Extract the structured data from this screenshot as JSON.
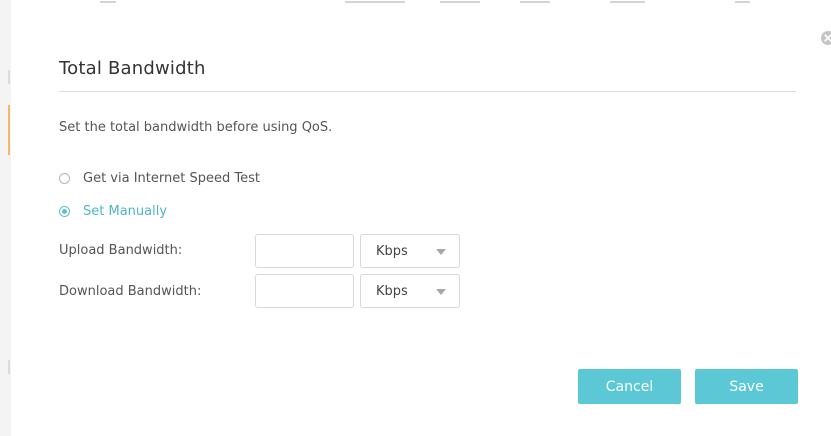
{
  "dialog": {
    "title": "Total Bandwidth",
    "description": "Set the total bandwidth before using QoS.",
    "close_icon": "close-circle-icon"
  },
  "options": {
    "speed_test_label": "Get via Internet Speed Test",
    "manual_label": "Set Manually",
    "selected": "manual"
  },
  "fields": {
    "upload": {
      "label": "Upload Bandwidth:",
      "value": "",
      "unit": "Kbps"
    },
    "download": {
      "label": "Download Bandwidth:",
      "value": "",
      "unit": "Kbps"
    }
  },
  "buttons": {
    "cancel_label": "Cancel",
    "save_label": "Save"
  },
  "colors": {
    "accent": "#5cc8d6",
    "accent_text": "#4db8c4",
    "divider": "#dcdcdc"
  }
}
